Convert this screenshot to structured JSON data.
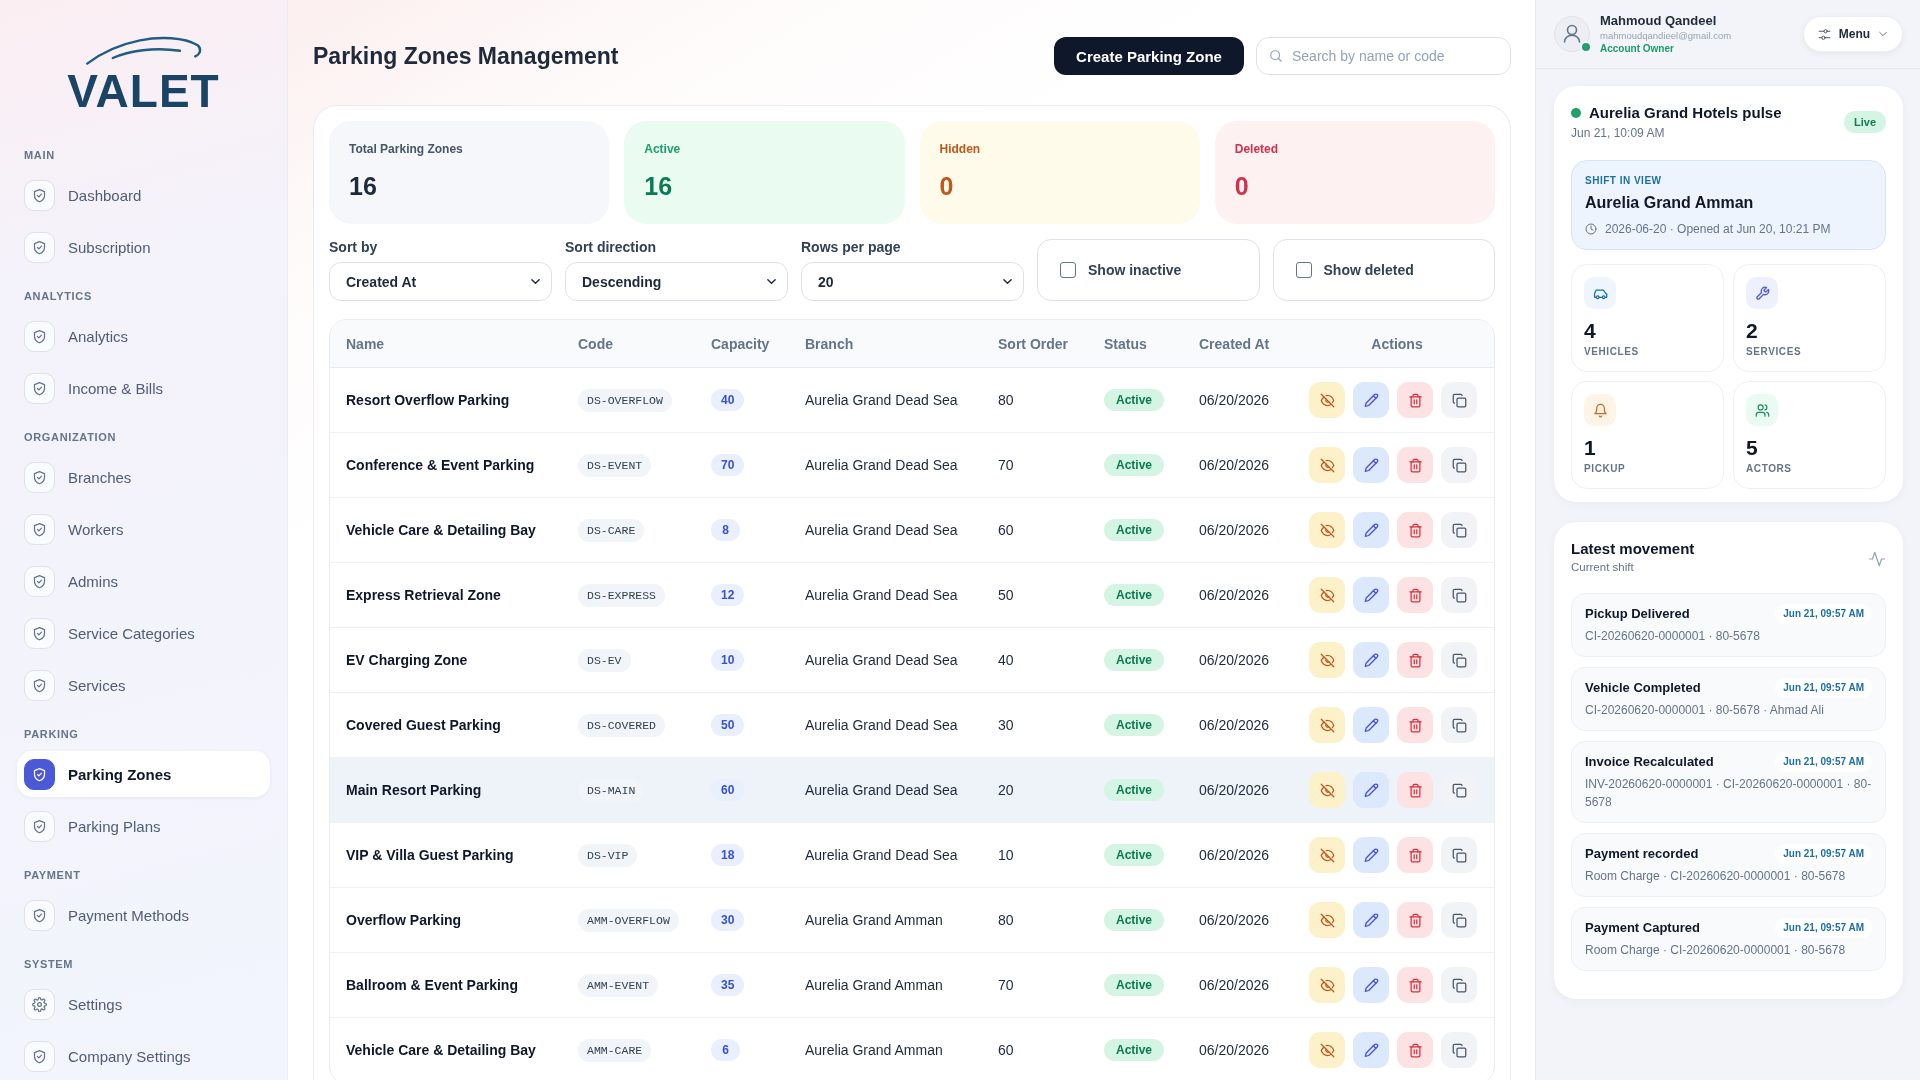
{
  "sidebar": {
    "logo": {
      "text": "VALET"
    },
    "sections": [
      {
        "title": "MAIN",
        "items": [
          {
            "label": "Dashboard",
            "kind": "page",
            "selected": false
          },
          {
            "label": "Subscription",
            "kind": "page",
            "selected": false
          }
        ]
      },
      {
        "title": "ANALYTICS",
        "items": [
          {
            "label": "Analytics",
            "kind": "page",
            "selected": false
          },
          {
            "label": "Income & Bills",
            "kind": "page",
            "selected": false
          }
        ]
      },
      {
        "title": "ORGANIZATION",
        "items": [
          {
            "label": "Branches",
            "kind": "page",
            "selected": false
          },
          {
            "label": "Workers",
            "kind": "page",
            "selected": false
          },
          {
            "label": "Admins",
            "kind": "page",
            "selected": false
          },
          {
            "label": "Service Categories",
            "kind": "page",
            "selected": false
          },
          {
            "label": "Services",
            "kind": "page",
            "selected": false
          }
        ]
      },
      {
        "title": "PARKING",
        "items": [
          {
            "label": "Parking Zones",
            "kind": "page",
            "selected": true
          },
          {
            "label": "Parking Plans",
            "kind": "page",
            "selected": false
          }
        ]
      },
      {
        "title": "PAYMENT",
        "items": [
          {
            "label": "Payment Methods",
            "kind": "page",
            "selected": false
          }
        ]
      },
      {
        "title": "SYSTEM",
        "items": [
          {
            "label": "Settings",
            "kind": "settings",
            "selected": false
          },
          {
            "label": "Company Settings",
            "kind": "page",
            "selected": false
          }
        ]
      }
    ]
  },
  "header": {
    "title": "Parking Zones Management",
    "create_button": {
      "label": "Create Parking Zone"
    },
    "search": {
      "placeholder": "Search by name or code"
    }
  },
  "stats": [
    {
      "label": "Total Parking Zones",
      "value": "16",
      "kind": "total"
    },
    {
      "label": "Active",
      "value": "16",
      "kind": "active"
    },
    {
      "label": "Hidden",
      "value": "0",
      "kind": "hidden"
    },
    {
      "label": "Deleted",
      "value": "0",
      "kind": "deleted"
    }
  ],
  "filters": {
    "selects": [
      {
        "label": "Sort by",
        "value": "Created At"
      },
      {
        "label": "Sort direction",
        "value": "Descending"
      },
      {
        "label": "Rows per page",
        "value": "20"
      }
    ],
    "checkboxes": [
      {
        "label": "Show inactive",
        "checked": false
      },
      {
        "label": "Show deleted",
        "checked": false
      }
    ]
  },
  "table": {
    "columns": [
      "Name",
      "Code",
      "Capacity",
      "Branch",
      "Sort Order",
      "Status",
      "Created At",
      "Actions"
    ],
    "rows": [
      {
        "name": "Resort Overflow Parking",
        "code": "DS-OVERFLOW",
        "capacity": "40",
        "branch": "Aurelia Grand Dead Sea",
        "sort_order": "80",
        "status": {
          "label": "Active",
          "kind": "active"
        },
        "created_at": "06/20/2026",
        "highlighted": false
      },
      {
        "name": "Conference & Event Parking",
        "code": "DS-EVENT",
        "capacity": "70",
        "branch": "Aurelia Grand Dead Sea",
        "sort_order": "70",
        "status": {
          "label": "Active",
          "kind": "active"
        },
        "created_at": "06/20/2026",
        "highlighted": false
      },
      {
        "name": "Vehicle Care & Detailing Bay",
        "code": "DS-CARE",
        "capacity": "8",
        "branch": "Aurelia Grand Dead Sea",
        "sort_order": "60",
        "status": {
          "label": "Active",
          "kind": "active"
        },
        "created_at": "06/20/2026",
        "highlighted": false
      },
      {
        "name": "Express Retrieval Zone",
        "code": "DS-EXPRESS",
        "capacity": "12",
        "branch": "Aurelia Grand Dead Sea",
        "sort_order": "50",
        "status": {
          "label": "Active",
          "kind": "active"
        },
        "created_at": "06/20/2026",
        "highlighted": false
      },
      {
        "name": "EV Charging Zone",
        "code": "DS-EV",
        "capacity": "10",
        "branch": "Aurelia Grand Dead Sea",
        "sort_order": "40",
        "status": {
          "label": "Active",
          "kind": "active"
        },
        "created_at": "06/20/2026",
        "highlighted": false
      },
      {
        "name": "Covered Guest Parking",
        "code": "DS-COVERED",
        "capacity": "50",
        "branch": "Aurelia Grand Dead Sea",
        "sort_order": "30",
        "status": {
          "label": "Active",
          "kind": "active"
        },
        "created_at": "06/20/2026",
        "highlighted": false
      },
      {
        "name": "Main Resort Parking",
        "code": "DS-MAIN",
        "capacity": "60",
        "branch": "Aurelia Grand Dead Sea",
        "sort_order": "20",
        "status": {
          "label": "Active",
          "kind": "active"
        },
        "created_at": "06/20/2026",
        "highlighted": true
      },
      {
        "name": "VIP & Villa Guest Parking",
        "code": "DS-VIP",
        "capacity": "18",
        "branch": "Aurelia Grand Dead Sea",
        "sort_order": "10",
        "status": {
          "label": "Active",
          "kind": "active"
        },
        "created_at": "06/20/2026",
        "highlighted": false
      },
      {
        "name": "Overflow Parking",
        "code": "AMM-OVERFLOW",
        "capacity": "30",
        "branch": "Aurelia Grand Amman",
        "sort_order": "80",
        "status": {
          "label": "Active",
          "kind": "active"
        },
        "created_at": "06/20/2026",
        "highlighted": false
      },
      {
        "name": "Ballroom & Event Parking",
        "code": "AMM-EVENT",
        "capacity": "35",
        "branch": "Aurelia Grand Amman",
        "sort_order": "70",
        "status": {
          "label": "Active",
          "kind": "active"
        },
        "created_at": "06/20/2026",
        "highlighted": false
      },
      {
        "name": "Vehicle Care & Detailing Bay",
        "code": "AMM-CARE",
        "capacity": "6",
        "branch": "Aurelia Grand Amman",
        "sort_order": "60",
        "status": {
          "label": "Active",
          "kind": "active"
        },
        "created_at": "06/20/2026",
        "highlighted": false
      }
    ]
  },
  "account": {
    "name": "Mahmoud Qandeel",
    "email": "mahmoudqandieel@gmail.com",
    "role": "Account Owner",
    "online": true,
    "menu_button": {
      "label": "Menu"
    }
  },
  "pulse": {
    "title": "Aurelia Grand Hotels pulse",
    "live": true,
    "badge": "Live",
    "timestamp": "Jun 21, 10:09 AM",
    "shift": {
      "eyebrow": "SHIFT IN VIEW",
      "name": "Aurelia Grand Amman",
      "detail": "2026-06-20 · Opened at Jun 20, 10:21 PM"
    },
    "metrics": [
      {
        "value": "4",
        "label": "VEHICLES",
        "kind": "vehicles"
      },
      {
        "value": "2",
        "label": "SERVICES",
        "kind": "services"
      },
      {
        "value": "1",
        "label": "PICKUP",
        "kind": "pickup"
      },
      {
        "value": "5",
        "label": "ACTORS",
        "kind": "actors"
      }
    ]
  },
  "movement": {
    "title": "Latest movement",
    "subtitle": "Current shift",
    "items": [
      {
        "title": "Pickup Delivered",
        "time": "Jun 21, 09:57 AM",
        "detail": "CI-20260620-0000001 · 80-5678"
      },
      {
        "title": "Vehicle Completed",
        "time": "Jun 21, 09:57 AM",
        "detail": "CI-20260620-0000001 · 80-5678 · Ahmad Ali"
      },
      {
        "title": "Invoice Recalculated",
        "time": "Jun 21, 09:57 AM",
        "detail": "INV-20260620-0000001 · CI-20260620-0000001 · 80-5678"
      },
      {
        "title": "Payment recorded",
        "time": "Jun 21, 09:57 AM",
        "detail": "Room Charge · CI-20260620-0000001 · 80-5678"
      },
      {
        "title": "Payment Captured",
        "time": "Jun 21, 09:57 AM",
        "detail": "Room Charge · CI-20260620-0000001 · 80-5678"
      }
    ]
  }
}
